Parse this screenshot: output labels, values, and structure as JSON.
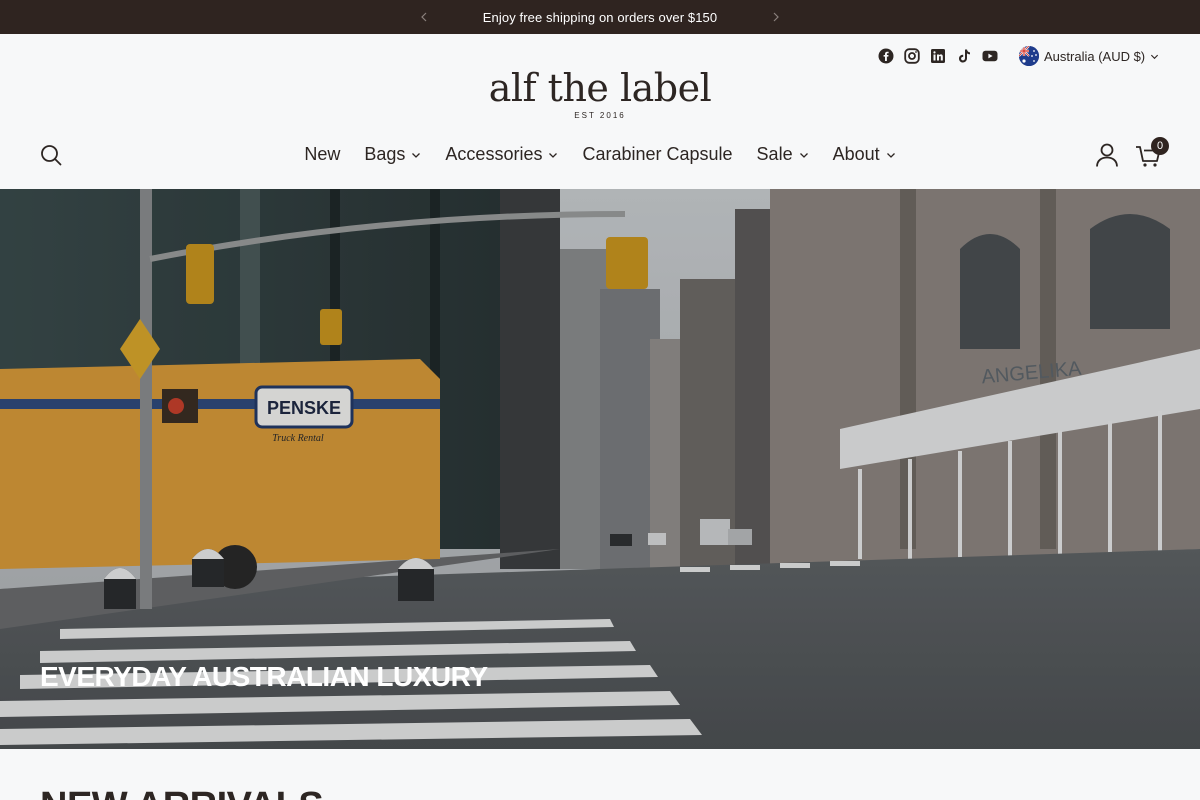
{
  "announcement": {
    "message": "Enjoy free shipping on orders over $150"
  },
  "header": {
    "logo_text": "alf the label",
    "logo_subtext": "EST 2016",
    "locale_label": "Australia (AUD $)",
    "cart_count": "0",
    "social_icons": [
      "facebook-icon",
      "instagram-icon",
      "linkedin-icon",
      "tiktok-icon",
      "youtube-icon"
    ]
  },
  "nav": {
    "items": [
      {
        "label": "New",
        "has_dropdown": false
      },
      {
        "label": "Bags",
        "has_dropdown": true
      },
      {
        "label": "Accessories",
        "has_dropdown": true
      },
      {
        "label": "Carabiner Capsule",
        "has_dropdown": false
      },
      {
        "label": "Sale",
        "has_dropdown": true
      },
      {
        "label": "About",
        "has_dropdown": true
      }
    ]
  },
  "hero": {
    "title": "EVERYDAY AUSTRALIAN LUXURY",
    "truck_text": "PENSKE",
    "truck_subtext": "Truck Rental",
    "sign_text": "ANGELIKA"
  },
  "section": {
    "title": "NEW ARRIVALS"
  },
  "colors": {
    "announcement_bg": "#2f2420",
    "page_bg": "#f7f8f9",
    "text": "#2d2623"
  }
}
